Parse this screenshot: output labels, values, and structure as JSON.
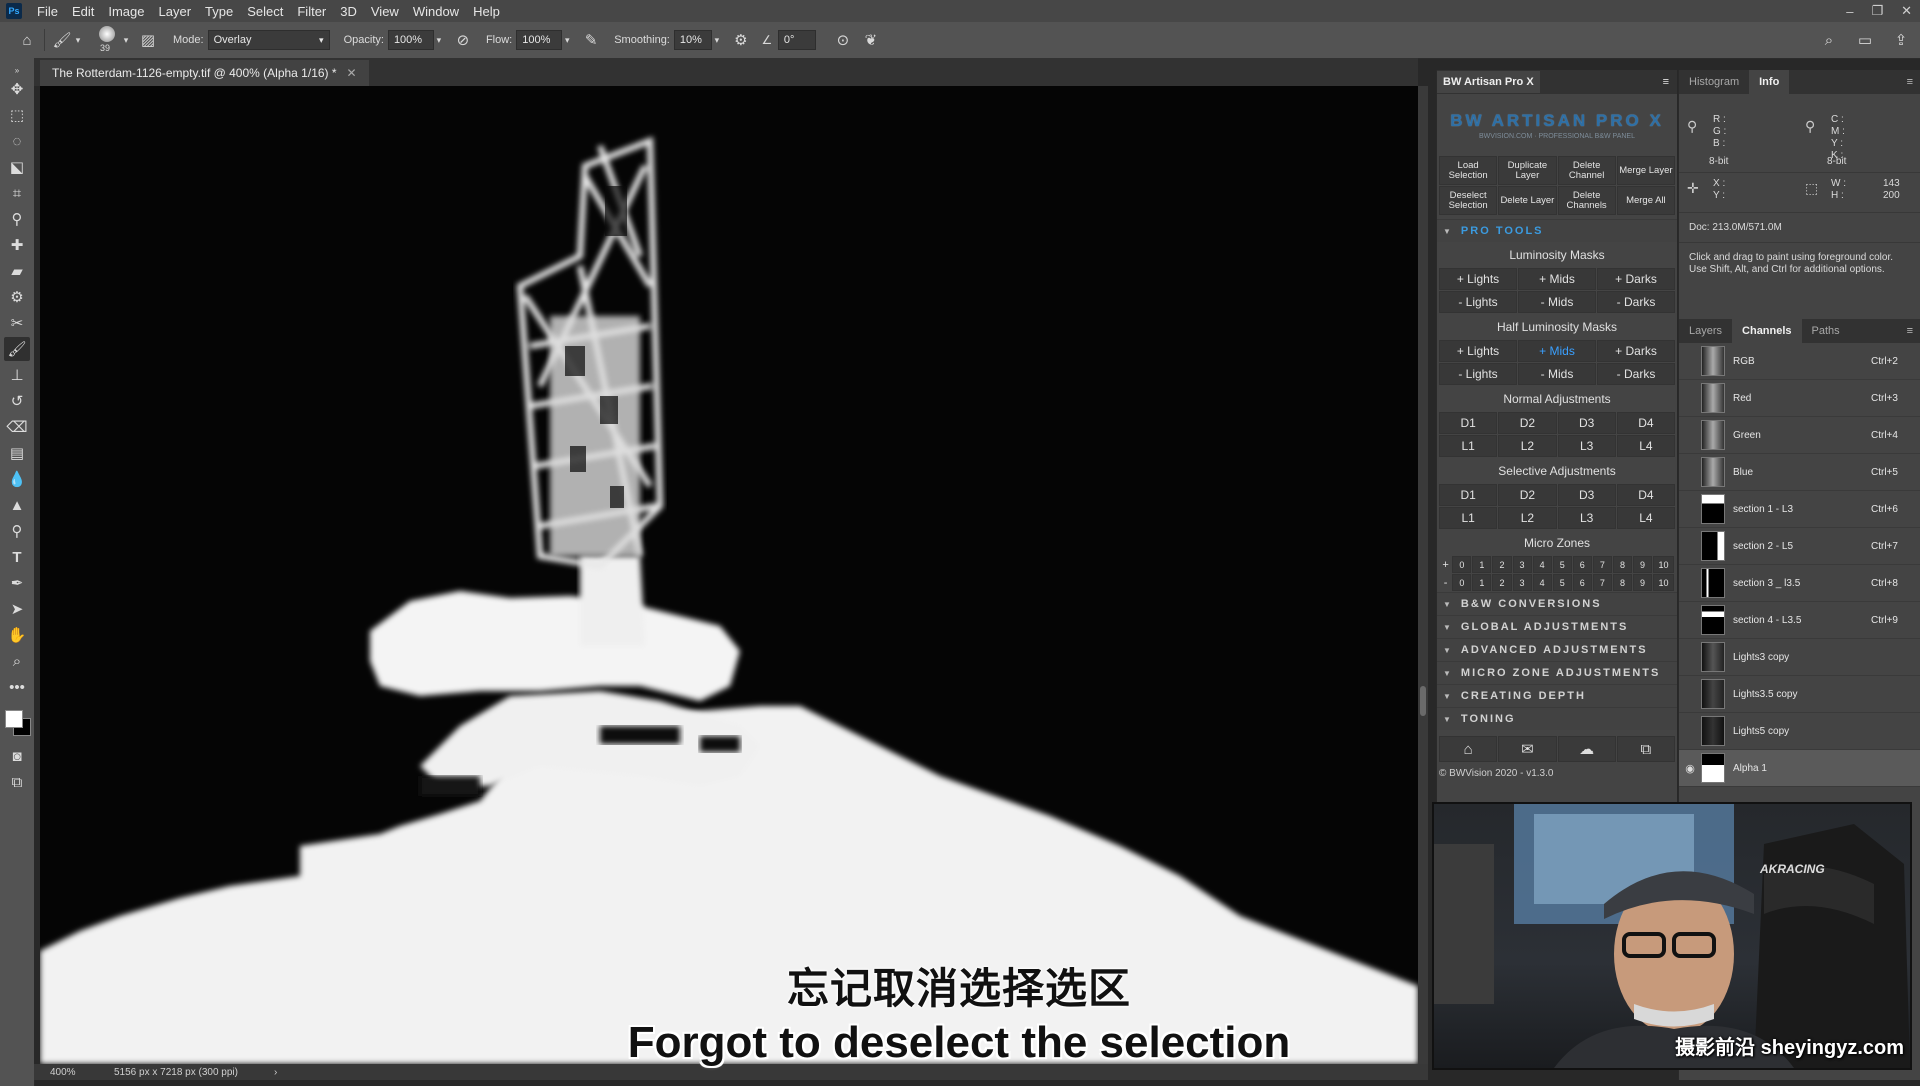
{
  "app": {
    "logo": "Ps",
    "menu": [
      "File",
      "Edit",
      "Image",
      "Layer",
      "Type",
      "Select",
      "Filter",
      "3D",
      "View",
      "Window",
      "Help"
    ]
  },
  "options": {
    "brush_size": "39",
    "mode_label": "Mode:",
    "mode_value": "Overlay",
    "opacity_label": "Opacity:",
    "opacity_value": "100%",
    "flow_label": "Flow:",
    "flow_value": "100%",
    "smoothing_label": "Smoothing:",
    "smoothing_value": "10%",
    "angle_value": "0°"
  },
  "document": {
    "tab_title": "The Rotterdam-1126-empty.tif @ 400% (Alpha 1/16) *",
    "zoom": "400%",
    "dimensions": "5156 px x 7218 px (300 ppi)"
  },
  "subtitles": {
    "zh": "忘记取消选择选区",
    "en": "Forgot to deselect the selection"
  },
  "artisan": {
    "tab_title": "BW Artisan Pro X",
    "logo": "BW ARTISAN PRO X",
    "logo_tag": "BWVISION.COM · PROFESSIONAL B&W PANEL",
    "top_buttons": [
      "Load Selection",
      "Duplicate Layer",
      "Delete Channel",
      "Merge Layer",
      "Deselect Selection",
      "Delete Layer",
      "Delete Channels",
      "Merge All"
    ],
    "pro_tools": "PRO TOOLS",
    "lum_title": "Luminosity Masks",
    "lum_plus": [
      "+ Lights",
      "+ Mids",
      "+ Darks"
    ],
    "lum_minus": [
      "- Lights",
      "- Mids",
      "- Darks"
    ],
    "half_title": "Half Luminosity Masks",
    "half_plus": [
      "+ Lights",
      "+ Mids",
      "+ Darks"
    ],
    "half_minus": [
      "- Lights",
      "- Mids",
      "- Darks"
    ],
    "normal_title": "Normal Adjustments",
    "normal_d": [
      "D1",
      "D2",
      "D3",
      "D4"
    ],
    "normal_l": [
      "L1",
      "L2",
      "L3",
      "L4"
    ],
    "selective_title": "Selective Adjustments",
    "selective_d": [
      "D1",
      "D2",
      "D3",
      "D4"
    ],
    "selective_l": [
      "L1",
      "L2",
      "L3",
      "L4"
    ],
    "micro_title": "Micro Zones",
    "micro_plus_sign": "+",
    "micro_minus_sign": "-",
    "micro_values": [
      "0",
      "1",
      "2",
      "3",
      "4",
      "5",
      "6",
      "7",
      "8",
      "9",
      "10"
    ],
    "sections": [
      "B&W CONVERSIONS",
      "GLOBAL ADJUSTMENTS",
      "ADVANCED ADJUSTMENTS",
      "MICRO ZONE ADJUSTMENTS",
      "CREATING DEPTH",
      "TONING"
    ],
    "footer_icons": [
      "home-icon",
      "mail-icon",
      "cloud-upload-icon",
      "export-icon"
    ],
    "version": "© BWVision 2020 - v1.3.0"
  },
  "info_panel": {
    "tabs": [
      "Histogram",
      "Info"
    ],
    "rgb_labels": "R :\nG :\nB :",
    "cmyk_labels": "C :\nM :\nY :\nK :",
    "bit_left": "8-bit",
    "bit_right": "8-bit",
    "xy_labels": "X :\nY :",
    "wh_labels": "W :\nH :",
    "w_value": "143",
    "h_value": "200",
    "doc_size": "Doc: 213.0M/571.0M",
    "hint": "Click and drag to paint using foreground color. Use Shift, Alt, and Ctrl for additional options."
  },
  "channels_panel": {
    "tabs": [
      "Layers",
      "Channels",
      "Paths"
    ],
    "channels": [
      {
        "name": "RGB",
        "key": "Ctrl+2"
      },
      {
        "name": "Red",
        "key": "Ctrl+3"
      },
      {
        "name": "Green",
        "key": "Ctrl+4"
      },
      {
        "name": "Blue",
        "key": "Ctrl+5"
      },
      {
        "name": "section 1 - L3",
        "key": "Ctrl+6"
      },
      {
        "name": "section 2 - L5",
        "key": "Ctrl+7"
      },
      {
        "name": "section 3 _ l3.5",
        "key": "Ctrl+8"
      },
      {
        "name": "section 4 - L3.5",
        "key": "Ctrl+9"
      },
      {
        "name": "Lights3 copy",
        "key": ""
      },
      {
        "name": "Lights3.5 copy",
        "key": ""
      },
      {
        "name": "Lights5 copy",
        "key": ""
      },
      {
        "name": "Alpha 1",
        "key": ""
      }
    ]
  },
  "webcam": {
    "chair_brand": "AKRACING",
    "watermark": "摄影前沿 sheyingyz.com"
  }
}
